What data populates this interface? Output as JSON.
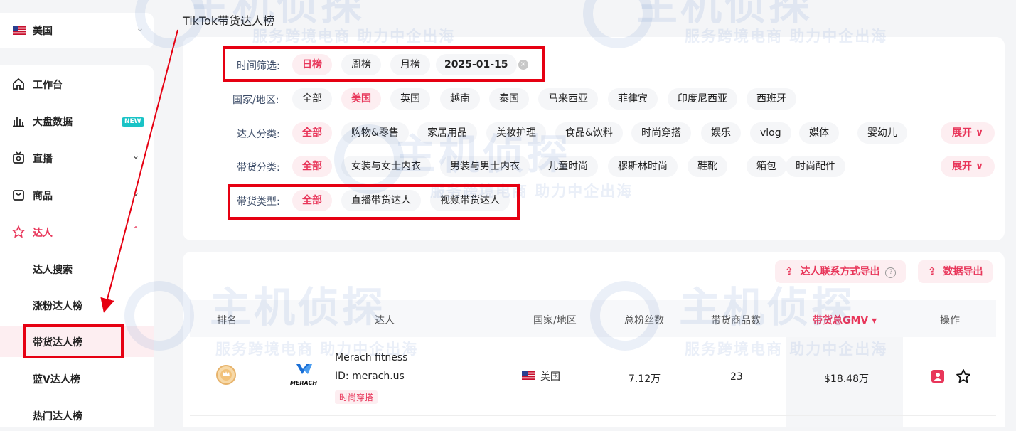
{
  "sidebar": {
    "country": "美国",
    "nav": [
      {
        "label": "工作台"
      },
      {
        "label": "大盘数据",
        "badge": "NEW"
      },
      {
        "label": "直播"
      },
      {
        "label": "商品"
      },
      {
        "label": "达人"
      }
    ],
    "sub": [
      "达人搜索",
      "涨粉达人榜",
      "带货达人榜",
      "蓝V达人榜",
      "热门达人榜"
    ]
  },
  "page": {
    "title": "TikTok带货达人榜"
  },
  "filters": {
    "time": {
      "label": "时间筛选:",
      "options": [
        "日榜",
        "周榜",
        "月榜"
      ],
      "date": "2025-01-15"
    },
    "country": {
      "label": "国家/地区:",
      "options": [
        "全部",
        "美国",
        "英国",
        "越南",
        "泰国",
        "马来西亚",
        "菲律宾",
        "印度尼西亚",
        "西班牙"
      ]
    },
    "creator_category": {
      "label": "达人分类:",
      "options": [
        "全部",
        "购物&零售",
        "家居用品",
        "美妆护理",
        "食品&饮料",
        "时尚穿搭",
        "娱乐",
        "vlog",
        "媒体",
        "婴幼儿"
      ],
      "expand": "展开"
    },
    "goods_category": {
      "label": "带货分类:",
      "options": [
        "全部",
        "女装与女士内衣",
        "男装与男士内衣",
        "儿童时尚",
        "穆斯林时尚",
        "鞋靴",
        "箱包",
        "时尚配件"
      ],
      "expand": "展开"
    },
    "goods_type": {
      "label": "带货类型:",
      "options": [
        "全部",
        "直播带货达人",
        "视频带货达人"
      ]
    }
  },
  "table": {
    "export_contact": "达人联系方式导出",
    "export_data": "数据导出",
    "columns": [
      "排名",
      "达人",
      "国家/地区",
      "总粉丝数",
      "带货商品数",
      "带货总GMV",
      "操作"
    ],
    "rows": [
      {
        "logo_text": "MERACH",
        "name": "Merach fitness",
        "id": "ID:  merach.us",
        "tag": "时尚穿搭",
        "country": "美国",
        "followers": "7.12万",
        "products": "23",
        "gmv": "$18.48万"
      }
    ]
  },
  "watermark": {
    "logo": "主机侦探",
    "slogan": "服务跨境电商 助力中企出海"
  },
  "colors": {
    "accent": "#e8365a",
    "highlight": "#e60012",
    "badge": "#19c3c6"
  }
}
